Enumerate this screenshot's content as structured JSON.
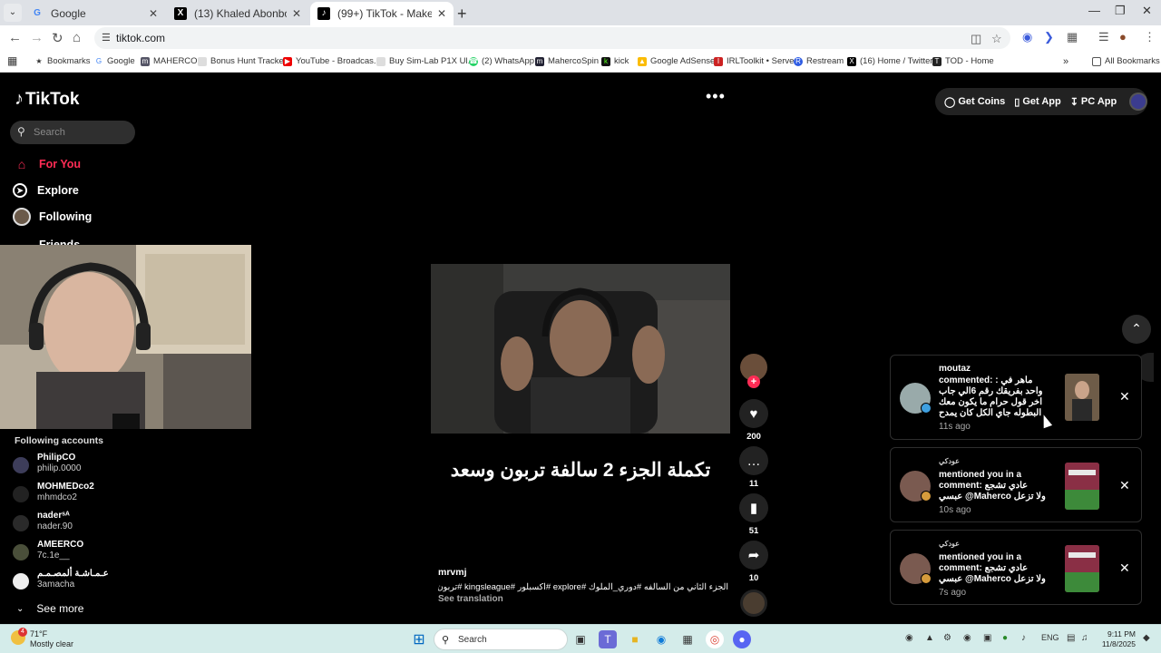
{
  "browser": {
    "tabs": [
      {
        "title": "Google",
        "favicon": "google-icon"
      },
      {
        "title": "(13) Khaled Abonbot (@k_abon",
        "favicon": "x-icon"
      },
      {
        "title": "(99+) TikTok - Make Your Da",
        "favicon": "tiktok-icon",
        "active": true
      }
    ],
    "url": "tiktok.com",
    "bookmarks": [
      "Bookmarks",
      "Google",
      "MAHERCO",
      "Bonus Hunt Tracker",
      "YouTube - Broadcas...",
      "Buy Sim-Lab P1X Ul...",
      "(2) WhatsApp",
      "MahercoSpin",
      "kick",
      "Google AdSense",
      "IRLToolkit • Server",
      "Restream",
      "(16) Home / Twitter",
      "TOD - Home"
    ],
    "all_bookmarks": "All Bookmarks"
  },
  "tiktok": {
    "logo": "TikTok",
    "search_placeholder": "Search",
    "nav": {
      "for_you": "For You",
      "explore": "Explore",
      "following": "Following",
      "friends": "Friends"
    },
    "following_title": "Following accounts",
    "accounts": [
      {
        "name": "PhilipCO",
        "user": "philip.0000"
      },
      {
        "name": "MOHMEDco2",
        "user": "mhmdco2"
      },
      {
        "name": "naderˢᴬ",
        "user": "nader.90"
      },
      {
        "name": "AMEERCO",
        "user": "7c.1e__"
      },
      {
        "name": "عـمـاشـة ألمصـمـم",
        "user": "3amacha"
      }
    ],
    "see_more": "See more",
    "top": {
      "get_coins": "Get Coins",
      "get_app": "Get App",
      "pc_app": "PC App"
    },
    "video": {
      "caption": "تكملة الجزء 2 سالفة تربون وسعد",
      "author": "mrvmj",
      "description": "الجزء الثاني من السالفه #دوري_الملوك #explore #اكسبلور #kingsleague #تربون",
      "see_translation": "See translation",
      "likes": "200",
      "comments": "11",
      "saves": "51",
      "shares": "10"
    },
    "notifications": [
      {
        "who": "moutaz",
        "text": "commented: : ماهر في واحد بفريقك رقم 6الي جاب اخر قول حرام ما يكون معك البطوله جاي الكل كان يمدح فيه وعينهم عليه",
        "when": "11s ago"
      },
      {
        "who": "عودكي",
        "text": "mentioned you in a comment: عادي تشجع عبسي @Maherco ولا تزعل",
        "when": "10s ago"
      },
      {
        "who": "عودكي",
        "text": "mentioned you in a comment: عادي تشجع عبسي @Maherco ولا تزعل",
        "when": "7s ago"
      }
    ]
  },
  "taskbar": {
    "temp": "71°F",
    "condition": "Mostly clear",
    "weather_badge": "4",
    "search": "Search",
    "lang": "ENG",
    "time": "9:11 PM",
    "date": "11/8/2025"
  },
  "colors": {
    "accent": "#fe2c55",
    "background": "#000000",
    "taskbar": "#d4ecea"
  }
}
